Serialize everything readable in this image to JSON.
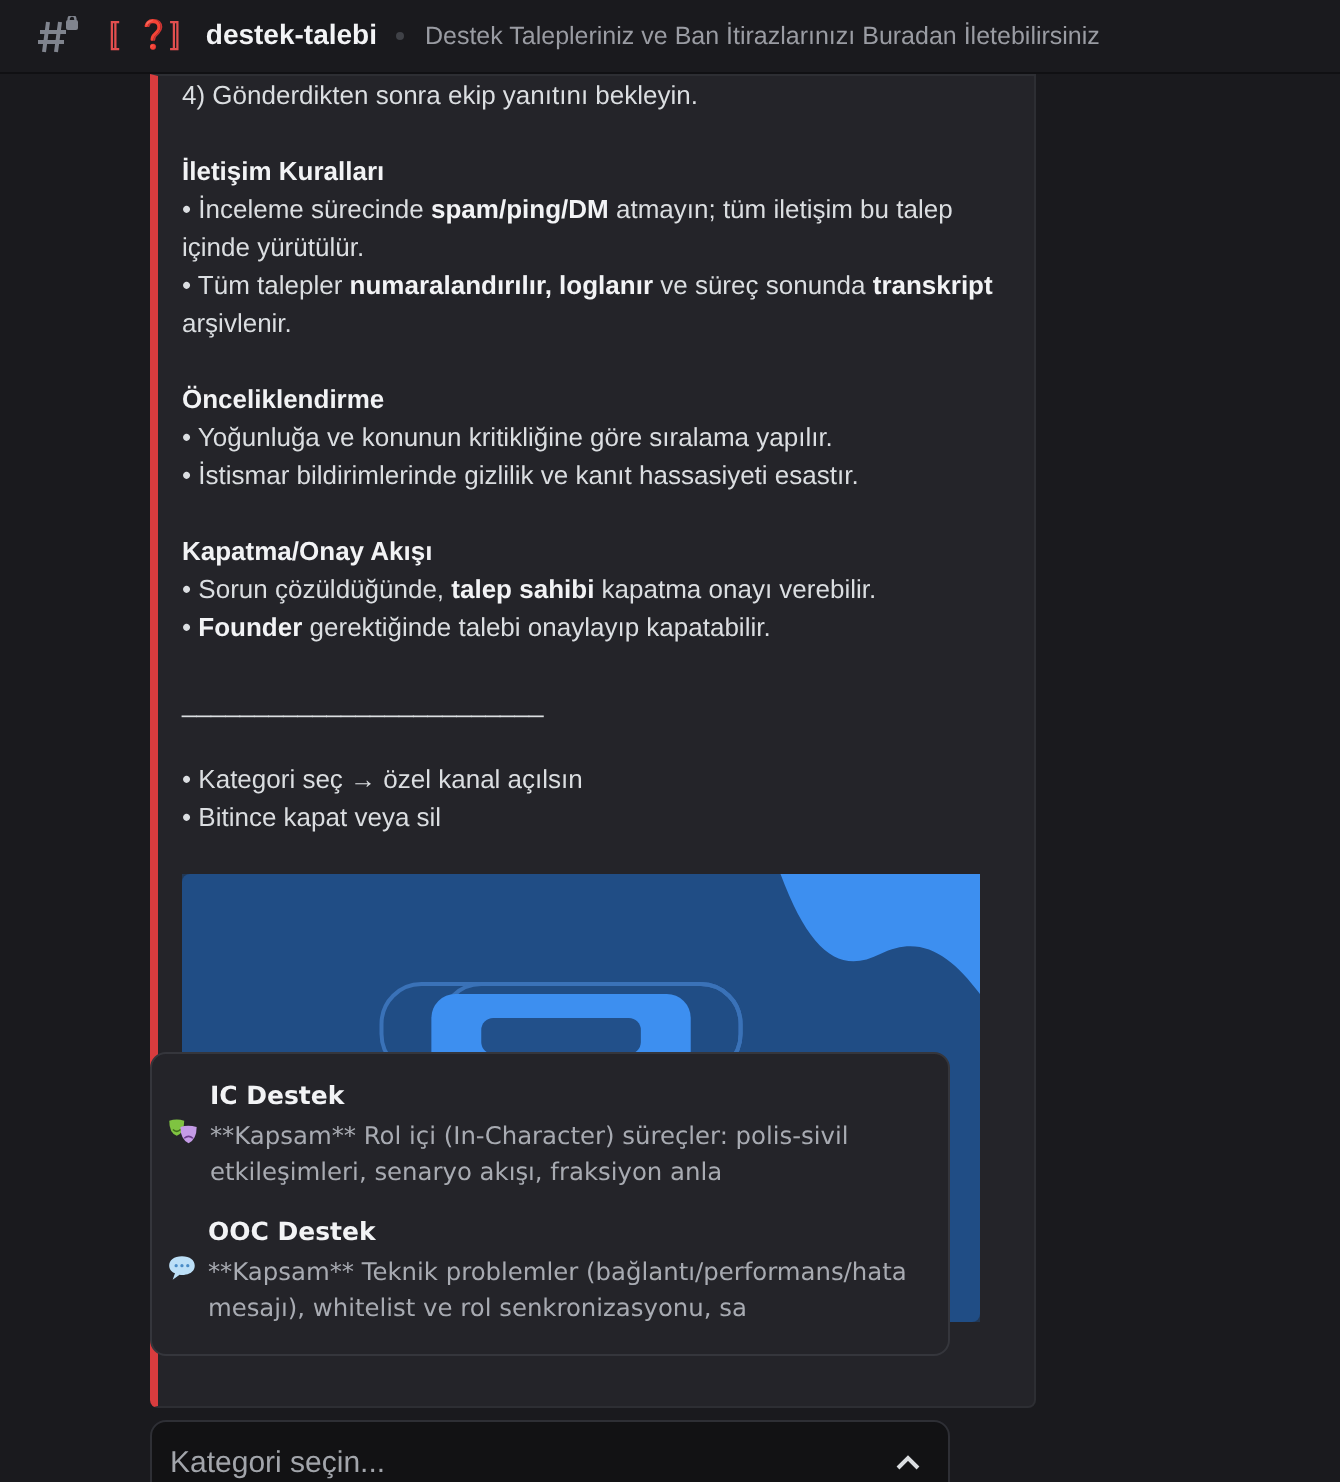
{
  "header": {
    "channel_prefix": "〚❓〛",
    "channel_name": "destek-talebi",
    "topic": "Destek Talepleriniz ve Ban İtirazlarınızı Buradan İletebilirsiniz"
  },
  "embed": {
    "blocks": [
      {
        "kind": "lines",
        "lines": [
          "4) Gönderdikten sonra ekip yanıtını bekleyin."
        ]
      },
      {
        "kind": "section",
        "heading": "İletişim Kuralları",
        "lines": [
          "• İnceleme sürecinde **spam/ping/DM** atmayın; tüm iletişim bu talep içinde yürütülür.",
          "• Tüm talepler **numaralandırılır, loglanır** ve süreç sonunda **transkript** arşivlenir."
        ]
      },
      {
        "kind": "section",
        "heading": "Önceliklendirme",
        "lines": [
          "• Yoğunluğa ve konunun kritikliğine göre sıralama yapılır.",
          "• İstismar bildirimlerinde gizlilik ve kanıt hassasiyeti esastır."
        ]
      },
      {
        "kind": "section",
        "heading": "Kapatma/Onay Akışı",
        "lines": [
          "• Sorun çözüldüğünde, **talep sahibi** kapatma onayı verebilir.",
          "• **Founder** gerektiğinde talebi onaylayıp kapatabilir."
        ]
      },
      {
        "kind": "lines",
        "lines": [
          "_________________________"
        ]
      },
      {
        "kind": "lines",
        "lines": [
          "• Kategori seç → özel kanal açılsın",
          "• Bitince kapat veya sil"
        ]
      },
      {
        "kind": "picture"
      }
    ]
  },
  "dropdown": {
    "expanded": true,
    "options": [
      {
        "label": "IC Destek",
        "description": "**Kapsam** Rol içi (In-Character) süreçler: polis-sivil etkileşimleri, senaryo akışı, fraksiyon anla"
      },
      {
        "label": "OOC Destek",
        "description": "**Kapsam** Teknik problemler (bağlantı/performans/hata mesajı), whitelist ve rol senkronizasyonu, sa"
      }
    ]
  },
  "select": {
    "placeholder": "Kategori seçin..."
  }
}
